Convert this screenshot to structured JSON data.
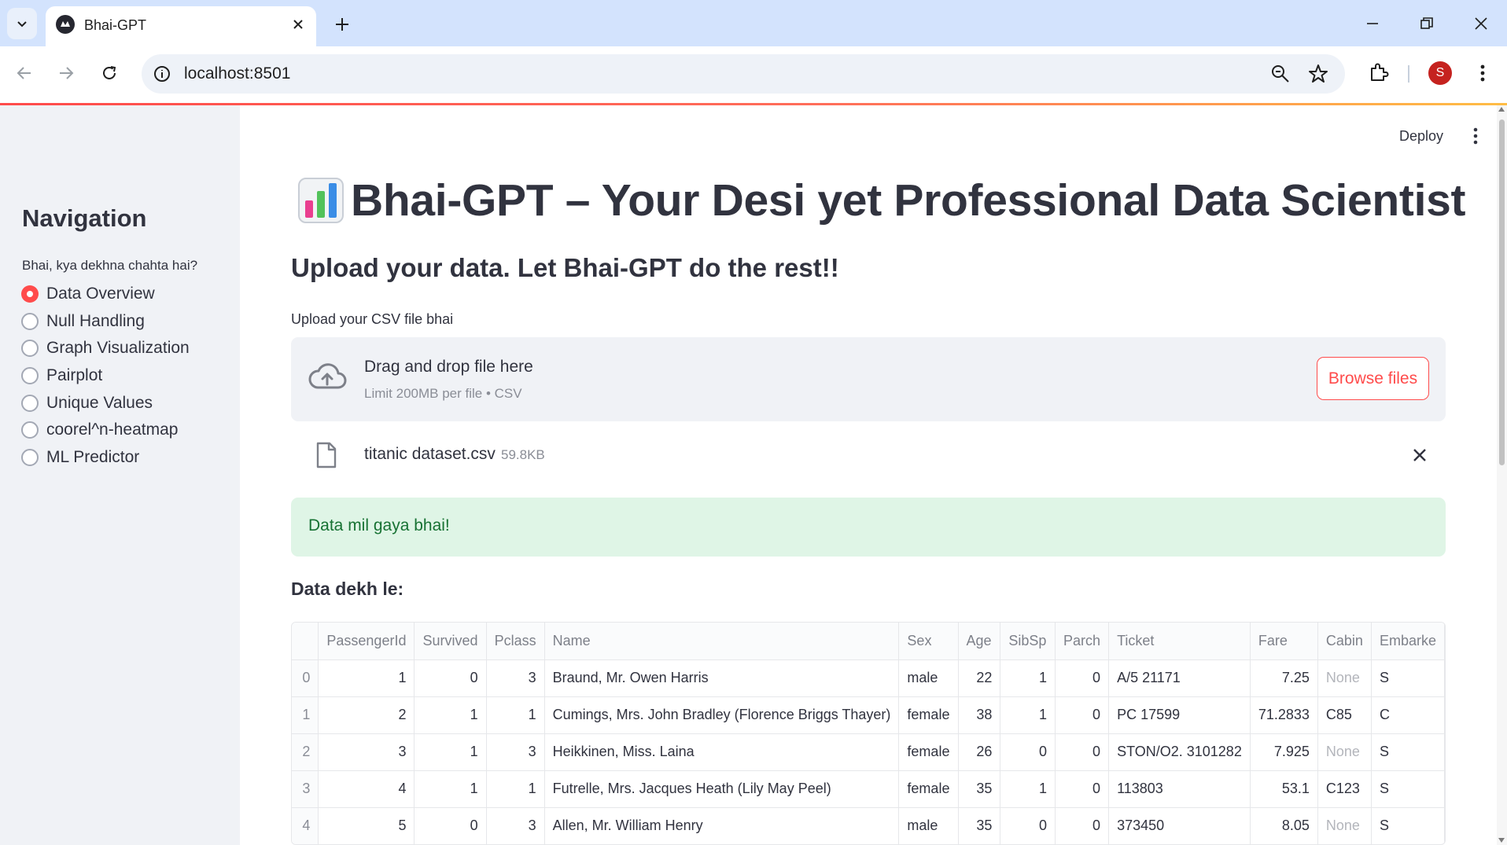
{
  "browser": {
    "tab_title": "Bhai-GPT",
    "url": "localhost:8501",
    "profile_initial": "S"
  },
  "header": {
    "deploy_label": "Deploy"
  },
  "sidebar": {
    "title": "Navigation",
    "question": "Bhai, kya dekhna chahta hai?",
    "options": [
      "Data Overview",
      "Null Handling",
      "Graph Visualization",
      "Pairplot",
      "Unique Values",
      "coorel^n-heatmap",
      "ML Predictor"
    ],
    "selected": "Data Overview"
  },
  "main": {
    "title_emoji": "bar-chart-emoji",
    "title": "Bhai-GPT – Your Desi yet Professional Data Scientist",
    "subheader": "Upload your data. Let Bhai-GPT do the rest!!",
    "uploader": {
      "label": "Upload your CSV file bhai",
      "drag_text": "Drag and drop file here",
      "limit_text": "Limit 200MB per file • CSV",
      "browse_label": "Browse files"
    },
    "file": {
      "name": "titanic dataset.csv",
      "size": "59.8KB"
    },
    "success_message": "Data mil gaya bhai!",
    "data_label": "Data dekh le:"
  },
  "table": {
    "columns": [
      "",
      "PassengerId",
      "Survived",
      "Pclass",
      "Name",
      "Sex",
      "Age",
      "SibSp",
      "Parch",
      "Ticket",
      "Fare",
      "Cabin",
      "Embarke"
    ],
    "rows": [
      [
        "0",
        "1",
        "0",
        "3",
        "Braund, Mr. Owen Harris",
        "male",
        "22",
        "1",
        "0",
        "A/5 21171",
        "7.25",
        "None",
        "S"
      ],
      [
        "1",
        "2",
        "1",
        "1",
        "Cumings, Mrs. John Bradley (Florence Briggs Thayer)",
        "female",
        "38",
        "1",
        "0",
        "PC 17599",
        "71.2833",
        "C85",
        "C"
      ],
      [
        "2",
        "3",
        "1",
        "3",
        "Heikkinen, Miss. Laina",
        "female",
        "26",
        "0",
        "0",
        "STON/O2. 3101282",
        "7.925",
        "None",
        "S"
      ],
      [
        "3",
        "4",
        "1",
        "1",
        "Futrelle, Mrs. Jacques Heath (Lily May Peel)",
        "female",
        "35",
        "1",
        "0",
        "113803",
        "53.1",
        "C123",
        "S"
      ],
      [
        "4",
        "5",
        "0",
        "3",
        "Allen, Mr. William Henry",
        "male",
        "35",
        "0",
        "0",
        "373450",
        "8.05",
        "None",
        "S"
      ]
    ]
  },
  "colors": {
    "accent": "#ff4b4b",
    "sidebar_bg": "#f0f2f6",
    "success_bg": "#dff5e6",
    "success_text": "#177233"
  }
}
